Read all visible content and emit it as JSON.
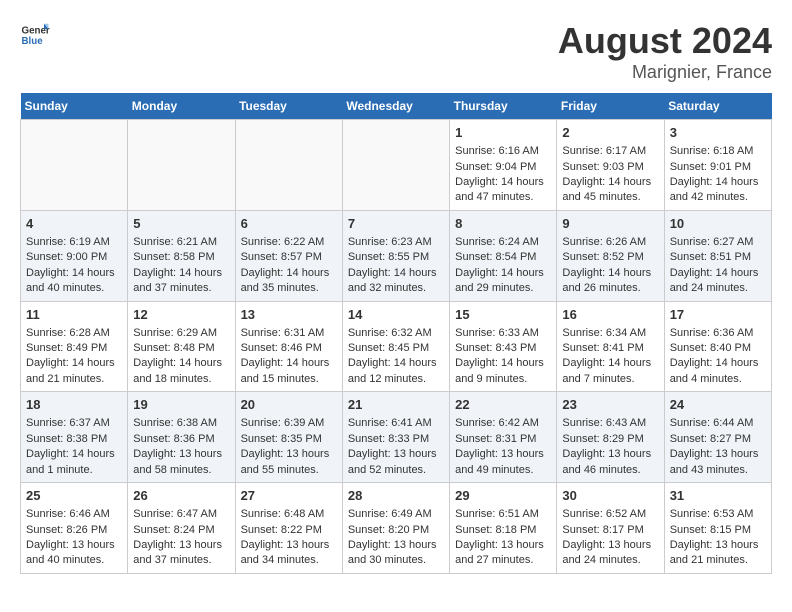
{
  "header": {
    "logo_general": "General",
    "logo_blue": "Blue",
    "month_year": "August 2024",
    "location": "Marignier, France"
  },
  "days_of_week": [
    "Sunday",
    "Monday",
    "Tuesday",
    "Wednesday",
    "Thursday",
    "Friday",
    "Saturday"
  ],
  "weeks": [
    [
      {
        "day": "",
        "content": ""
      },
      {
        "day": "",
        "content": ""
      },
      {
        "day": "",
        "content": ""
      },
      {
        "day": "",
        "content": ""
      },
      {
        "day": "1",
        "content": "Sunrise: 6:16 AM\nSunset: 9:04 PM\nDaylight: 14 hours and 47 minutes."
      },
      {
        "day": "2",
        "content": "Sunrise: 6:17 AM\nSunset: 9:03 PM\nDaylight: 14 hours and 45 minutes."
      },
      {
        "day": "3",
        "content": "Sunrise: 6:18 AM\nSunset: 9:01 PM\nDaylight: 14 hours and 42 minutes."
      }
    ],
    [
      {
        "day": "4",
        "content": "Sunrise: 6:19 AM\nSunset: 9:00 PM\nDaylight: 14 hours and 40 minutes."
      },
      {
        "day": "5",
        "content": "Sunrise: 6:21 AM\nSunset: 8:58 PM\nDaylight: 14 hours and 37 minutes."
      },
      {
        "day": "6",
        "content": "Sunrise: 6:22 AM\nSunset: 8:57 PM\nDaylight: 14 hours and 35 minutes."
      },
      {
        "day": "7",
        "content": "Sunrise: 6:23 AM\nSunset: 8:55 PM\nDaylight: 14 hours and 32 minutes."
      },
      {
        "day": "8",
        "content": "Sunrise: 6:24 AM\nSunset: 8:54 PM\nDaylight: 14 hours and 29 minutes."
      },
      {
        "day": "9",
        "content": "Sunrise: 6:26 AM\nSunset: 8:52 PM\nDaylight: 14 hours and 26 minutes."
      },
      {
        "day": "10",
        "content": "Sunrise: 6:27 AM\nSunset: 8:51 PM\nDaylight: 14 hours and 24 minutes."
      }
    ],
    [
      {
        "day": "11",
        "content": "Sunrise: 6:28 AM\nSunset: 8:49 PM\nDaylight: 14 hours and 21 minutes."
      },
      {
        "day": "12",
        "content": "Sunrise: 6:29 AM\nSunset: 8:48 PM\nDaylight: 14 hours and 18 minutes."
      },
      {
        "day": "13",
        "content": "Sunrise: 6:31 AM\nSunset: 8:46 PM\nDaylight: 14 hours and 15 minutes."
      },
      {
        "day": "14",
        "content": "Sunrise: 6:32 AM\nSunset: 8:45 PM\nDaylight: 14 hours and 12 minutes."
      },
      {
        "day": "15",
        "content": "Sunrise: 6:33 AM\nSunset: 8:43 PM\nDaylight: 14 hours and 9 minutes."
      },
      {
        "day": "16",
        "content": "Sunrise: 6:34 AM\nSunset: 8:41 PM\nDaylight: 14 hours and 7 minutes."
      },
      {
        "day": "17",
        "content": "Sunrise: 6:36 AM\nSunset: 8:40 PM\nDaylight: 14 hours and 4 minutes."
      }
    ],
    [
      {
        "day": "18",
        "content": "Sunrise: 6:37 AM\nSunset: 8:38 PM\nDaylight: 14 hours and 1 minute."
      },
      {
        "day": "19",
        "content": "Sunrise: 6:38 AM\nSunset: 8:36 PM\nDaylight: 13 hours and 58 minutes."
      },
      {
        "day": "20",
        "content": "Sunrise: 6:39 AM\nSunset: 8:35 PM\nDaylight: 13 hours and 55 minutes."
      },
      {
        "day": "21",
        "content": "Sunrise: 6:41 AM\nSunset: 8:33 PM\nDaylight: 13 hours and 52 minutes."
      },
      {
        "day": "22",
        "content": "Sunrise: 6:42 AM\nSunset: 8:31 PM\nDaylight: 13 hours and 49 minutes."
      },
      {
        "day": "23",
        "content": "Sunrise: 6:43 AM\nSunset: 8:29 PM\nDaylight: 13 hours and 46 minutes."
      },
      {
        "day": "24",
        "content": "Sunrise: 6:44 AM\nSunset: 8:27 PM\nDaylight: 13 hours and 43 minutes."
      }
    ],
    [
      {
        "day": "25",
        "content": "Sunrise: 6:46 AM\nSunset: 8:26 PM\nDaylight: 13 hours and 40 minutes."
      },
      {
        "day": "26",
        "content": "Sunrise: 6:47 AM\nSunset: 8:24 PM\nDaylight: 13 hours and 37 minutes."
      },
      {
        "day": "27",
        "content": "Sunrise: 6:48 AM\nSunset: 8:22 PM\nDaylight: 13 hours and 34 minutes."
      },
      {
        "day": "28",
        "content": "Sunrise: 6:49 AM\nSunset: 8:20 PM\nDaylight: 13 hours and 30 minutes."
      },
      {
        "day": "29",
        "content": "Sunrise: 6:51 AM\nSunset: 8:18 PM\nDaylight: 13 hours and 27 minutes."
      },
      {
        "day": "30",
        "content": "Sunrise: 6:52 AM\nSunset: 8:17 PM\nDaylight: 13 hours and 24 minutes."
      },
      {
        "day": "31",
        "content": "Sunrise: 6:53 AM\nSunset: 8:15 PM\nDaylight: 13 hours and 21 minutes."
      }
    ]
  ]
}
